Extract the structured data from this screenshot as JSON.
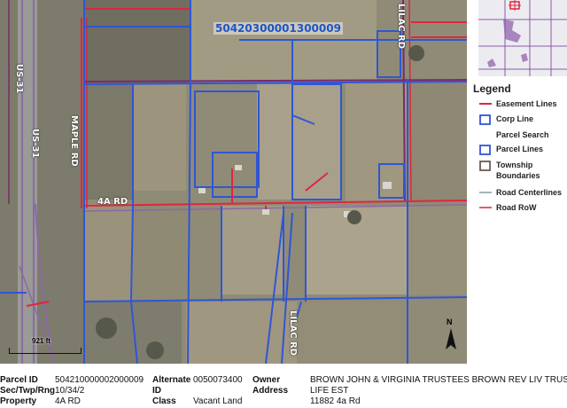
{
  "map": {
    "parcel_label": "50420300001300009",
    "road_labels": {
      "us31_a": "US-31",
      "us31_b": "US-31",
      "maple_rd": "MAPLE RD",
      "fourA_rd": "4A RD",
      "lilac_rd_top": "LILAC RD",
      "lilac_rd_bottom": "LILAC RD"
    },
    "scale_label": "921 ft",
    "north_label": "N",
    "colors": {
      "parcel_lines": "#2f56d6",
      "road_row": "#e0263c",
      "township": "#7a2a6a",
      "imagery": "#8e8a78"
    }
  },
  "legend": {
    "title": "Legend",
    "items": [
      {
        "label": "Easement Lines",
        "symbol": "red-line"
      },
      {
        "label": "Corp Line",
        "symbol": "blue-square"
      },
      {
        "label": "Parcel Search",
        "symbol": "none"
      },
      {
        "label": "Parcel Lines",
        "symbol": "blue-square"
      },
      {
        "label": "Township Boundaries",
        "symbol": "brown-square"
      },
      {
        "label": "Road Centerlines",
        "symbol": "gray-line"
      },
      {
        "label": "Road RoW",
        "symbol": "red-line"
      }
    ]
  },
  "info": {
    "parcel_id_label": "Parcel ID",
    "parcel_id_value": "504210000002000009",
    "sec_label": "Sec/Twp/Rng",
    "sec_value": "10/34/2",
    "property_label": "Property",
    "property_value": "4A RD",
    "alternate_label": "Alternate",
    "alternate_value": "0050073400",
    "id_label": "ID",
    "class_label": "Class",
    "class_value": "Vacant Land",
    "owner_label": "Owner",
    "owner_value_line1": "BROWN JOHN & VIRGINIA TRUSTEES BROWN REV LIV TRUST",
    "owner_value_line2": "LIFE EST",
    "address_label": "Address",
    "address_value": "11882 4a Rd"
  }
}
